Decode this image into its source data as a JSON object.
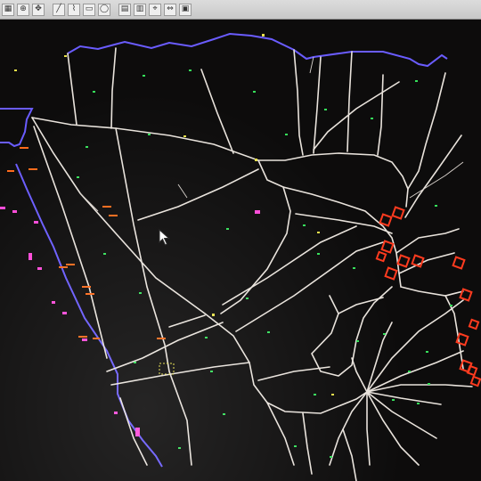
{
  "app": {
    "title": "",
    "view": "cadastral-map"
  },
  "toolbar": {
    "icons": [
      "select-icon",
      "zoom-icon",
      "pan-icon",
      "line-icon",
      "polyline-icon",
      "rectangle-icon",
      "circle-icon",
      "grid-icon",
      "layers-icon",
      "snap-icon",
      "measure-icon",
      "print-icon"
    ],
    "status_text": ""
  },
  "colors": {
    "background": "#0d0c0c",
    "parcel_line": "#e9e3dc",
    "boundary_line": "#6a5cff",
    "marker_orange": "#ff6a1a",
    "marker_red": "#ff3b1f",
    "point_green": "#35e05a",
    "point_yellow": "#e7e04a",
    "text_magenta": "#ff4ad8"
  }
}
